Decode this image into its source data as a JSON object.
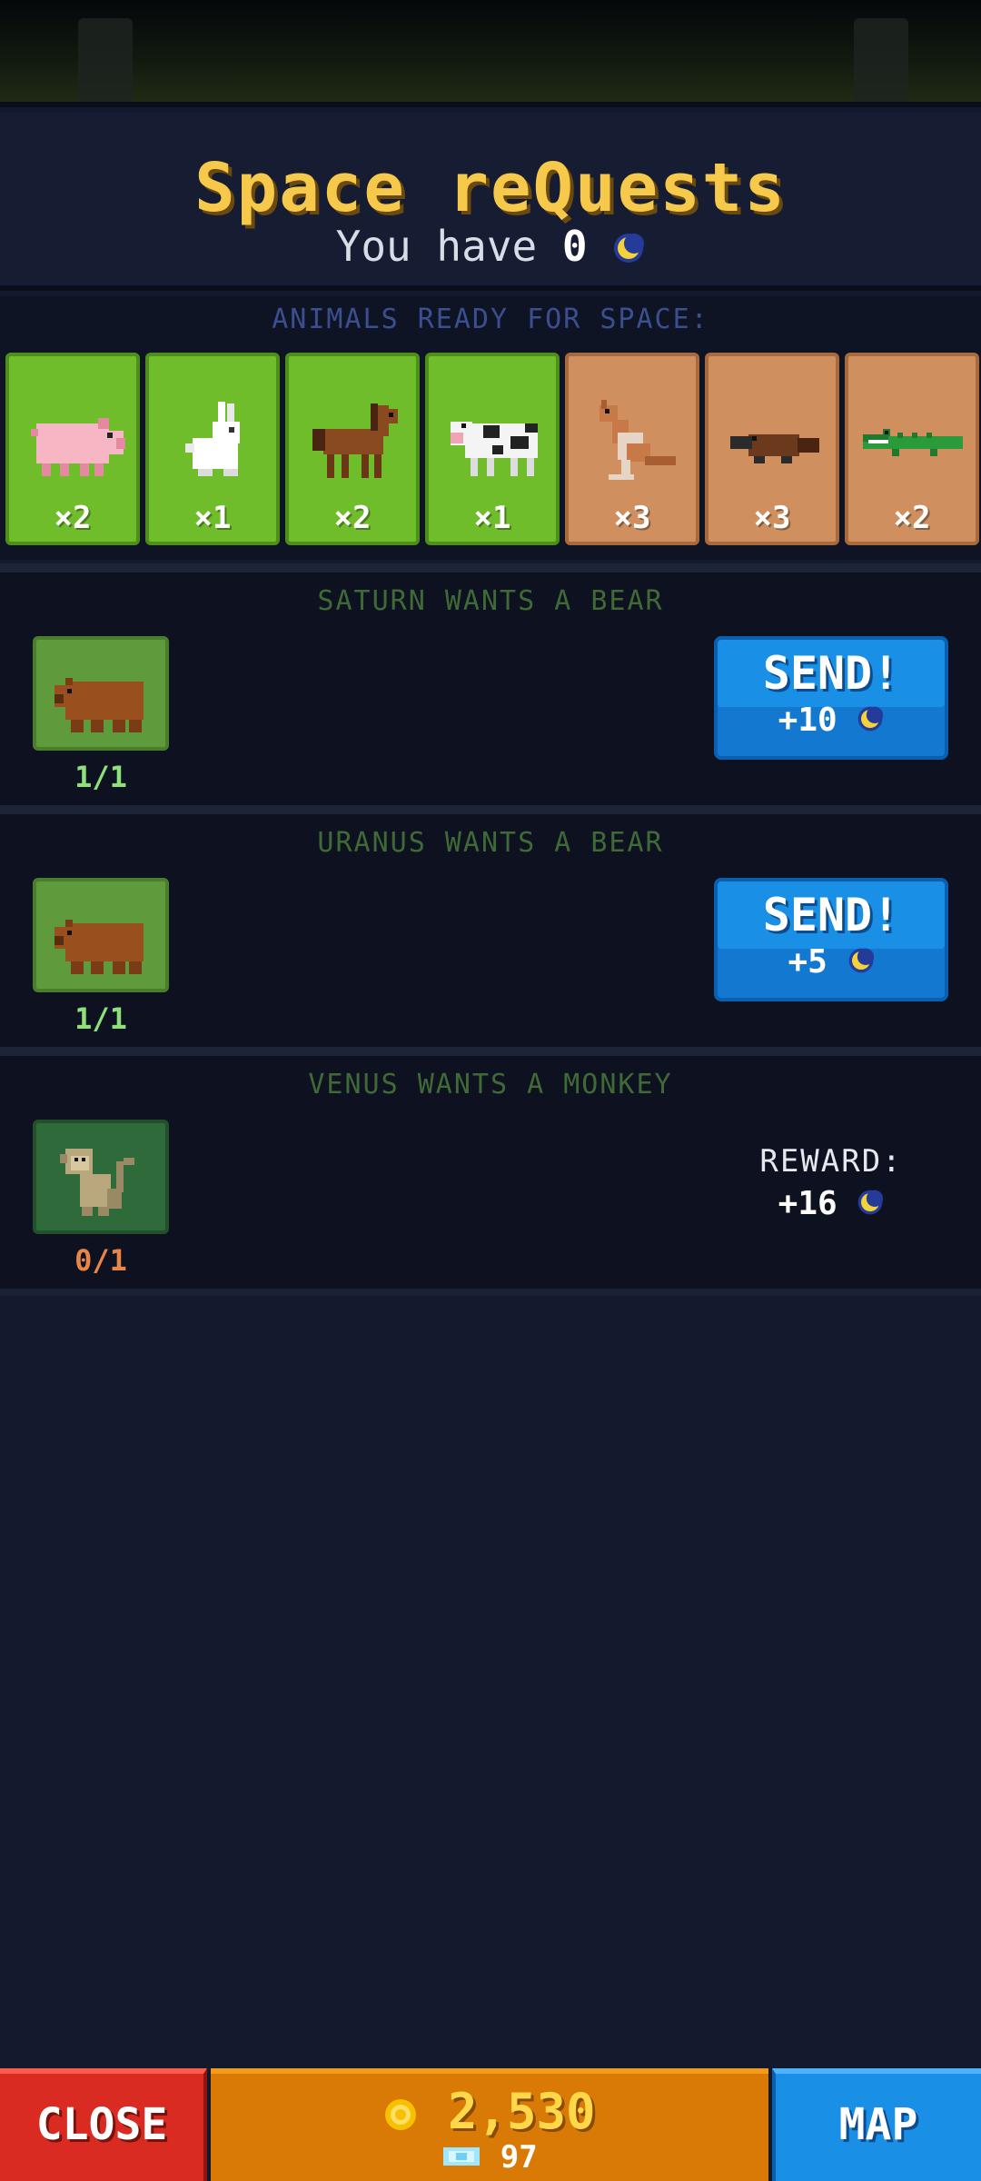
{
  "header": {
    "title": "Space reQuests",
    "have_prefix": "You have",
    "have_amount": "0",
    "currency_icon": "moon-coin-icon"
  },
  "animals": {
    "label": "ANIMALS READY FOR SPACE:",
    "cards": [
      {
        "animal": "pig",
        "count": "×2",
        "habitat": "grass"
      },
      {
        "animal": "rabbit",
        "count": "×1",
        "habitat": "grass"
      },
      {
        "animal": "horse",
        "count": "×2",
        "habitat": "grass"
      },
      {
        "animal": "cow",
        "count": "×1",
        "habitat": "grass"
      },
      {
        "animal": "kangaroo",
        "count": "×3",
        "habitat": "desert"
      },
      {
        "animal": "platypus",
        "count": "×3",
        "habitat": "desert"
      },
      {
        "animal": "crocodile",
        "count": "×2",
        "habitat": "desert"
      }
    ]
  },
  "requests": [
    {
      "title": "SATURN WANTS A BEAR",
      "animal": "bear",
      "progress": "1/1",
      "button_label": "SEND!",
      "reward": "+10"
    },
    {
      "title": "URANUS WANTS A BEAR",
      "animal": "bear",
      "progress": "1/1",
      "button_label": "SEND!",
      "reward": "+5"
    },
    {
      "title": "VENUS WANTS A MONKEY",
      "animal": "monkey",
      "progress": "0/1",
      "reward_label": "REWARD:",
      "reward": "+16"
    }
  ],
  "bottom_bar": {
    "close_label": "CLOSE",
    "gold": "2,530",
    "gems": "97",
    "map_label": "MAP"
  },
  "colors": {
    "title": "#f7c94b",
    "send_button": "#1a8fe6",
    "close_button": "#d92b22",
    "money_panel": "#d97a06",
    "grass_card": "#6fbd2a",
    "desert_card": "#d08f5f"
  }
}
